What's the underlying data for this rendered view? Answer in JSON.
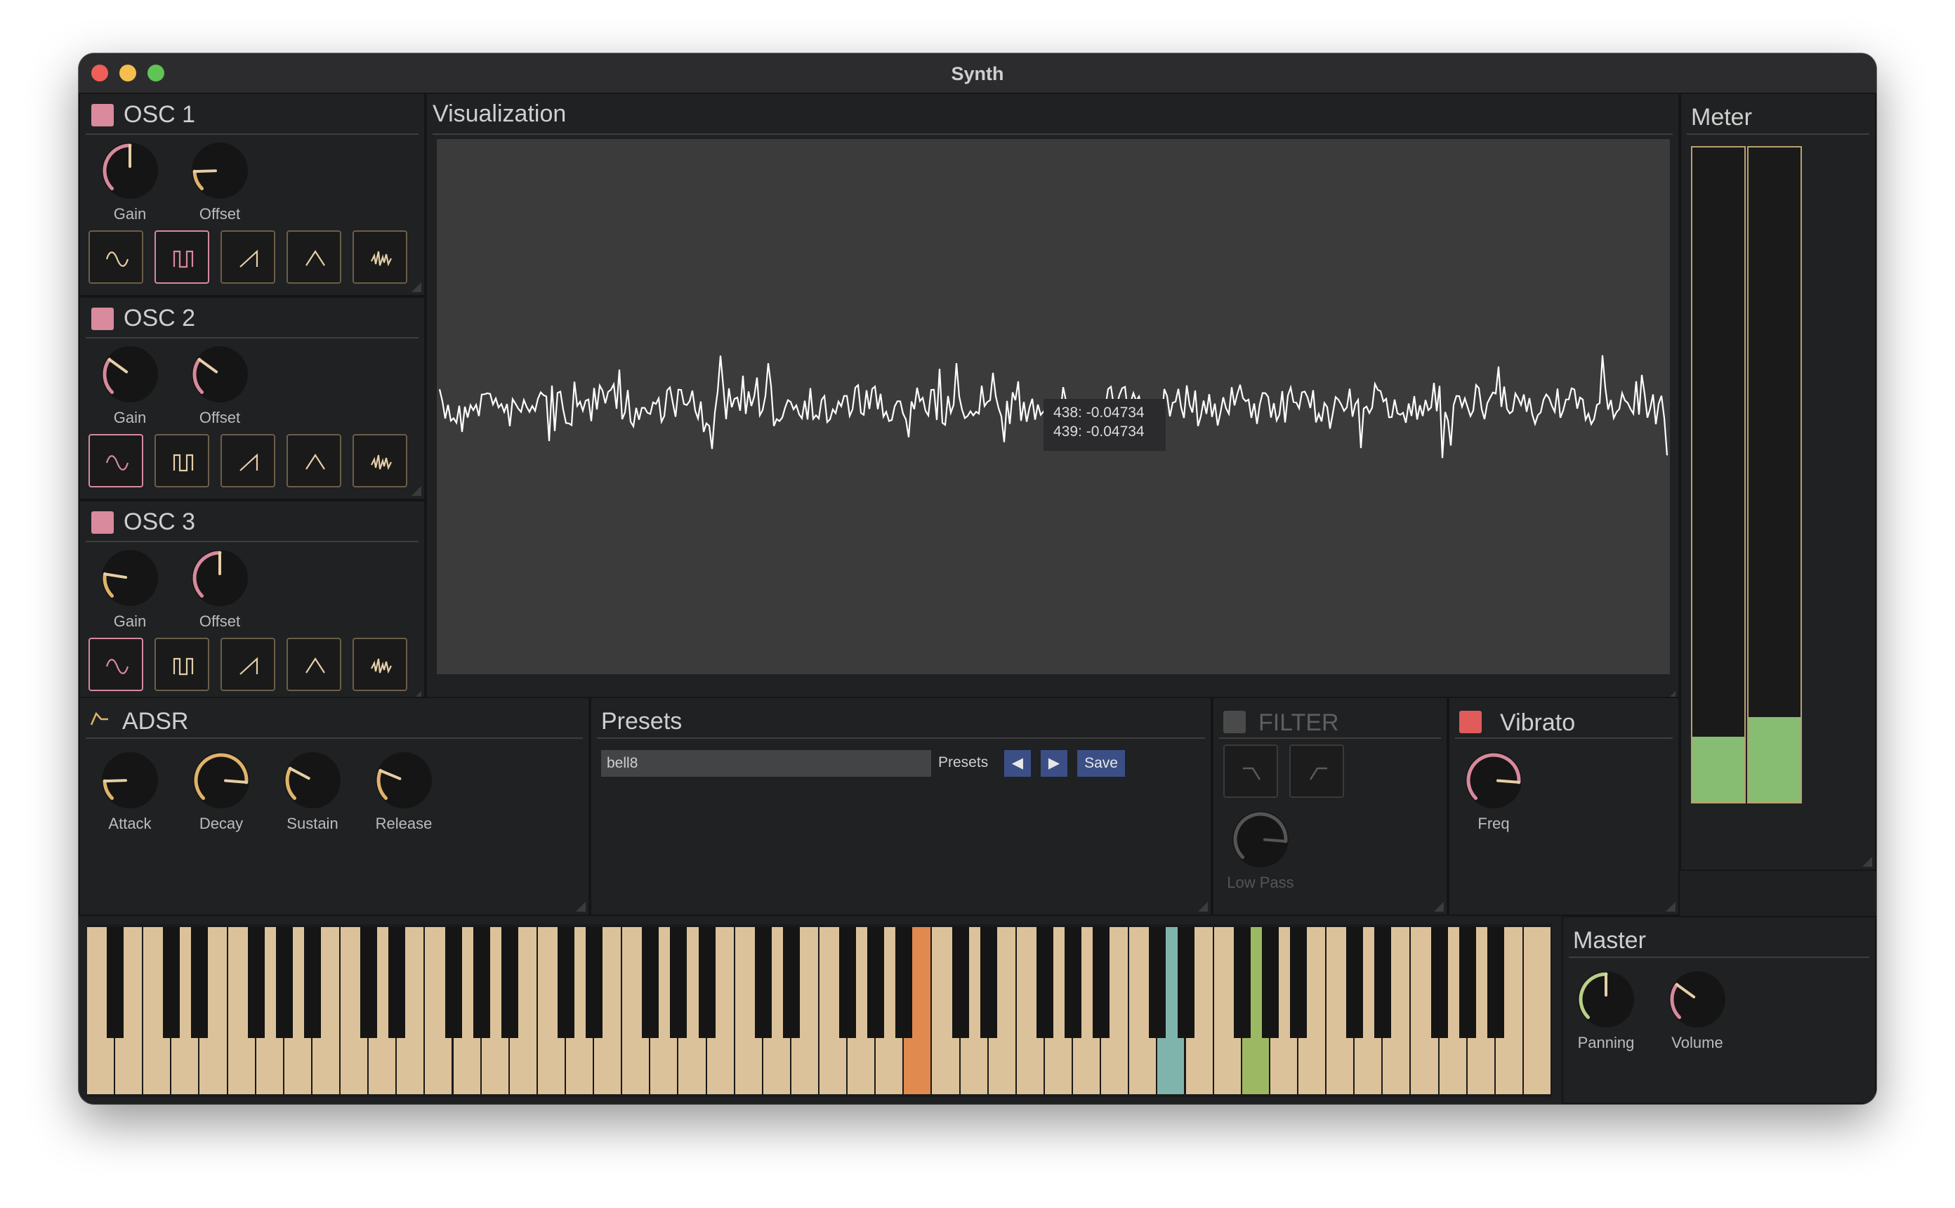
{
  "window": {
    "title": "Synth"
  },
  "colors": {
    "close": "#ee5f58",
    "minimize": "#f5be4f",
    "zoom": "#5fc454",
    "osc_checkbox": "#d98a9c",
    "vibrato_checkbox": "#e15b5b",
    "filter_checkbox": "#4a4a4a",
    "knob_pink": "#d8899c",
    "knob_gold": "#e0b36a",
    "knob_green": "#b9cf86",
    "wave_line": "#ffffff",
    "meter_fill": "#86bd73",
    "key_white": "#dcc29a",
    "key_orange": "#e08a4f",
    "key_teal": "#7fb4ad",
    "key_green": "#9db862",
    "button_blue": "#3b4f86"
  },
  "oscillators": [
    {
      "title": "OSC 1",
      "enabled": true,
      "knobs": [
        {
          "label": "Gain",
          "value": 0.5,
          "color": "pink"
        },
        {
          "label": "Offset",
          "value": 0.16,
          "color": "gold"
        }
      ],
      "waveforms": [
        "sine",
        "square",
        "saw",
        "triangle",
        "noise"
      ],
      "selected": "square"
    },
    {
      "title": "OSC 2",
      "enabled": true,
      "knobs": [
        {
          "label": "Gain",
          "value": 0.3,
          "color": "pink"
        },
        {
          "label": "Offset",
          "value": 0.3,
          "color": "pink"
        }
      ],
      "waveforms": [
        "sine",
        "square",
        "saw",
        "triangle",
        "noise"
      ],
      "selected": "sine"
    },
    {
      "title": "OSC 3",
      "enabled": true,
      "knobs": [
        {
          "label": "Gain",
          "value": 0.2,
          "color": "gold"
        },
        {
          "label": "Offset",
          "value": 0.5,
          "color": "pink"
        }
      ],
      "waveforms": [
        "sine",
        "square",
        "saw",
        "triangle",
        "noise"
      ],
      "selected": "sine"
    }
  ],
  "visualization": {
    "title": "Visualization",
    "tooltip": [
      "438: -0.04734",
      "439: -0.04734"
    ]
  },
  "meter": {
    "title": "Meter",
    "levels": [
      0.1,
      0.13
    ]
  },
  "adsr": {
    "title": "ADSR",
    "icon": "envelope-icon",
    "knobs": [
      {
        "label": "Attack",
        "value": 0.16,
        "color": "gold"
      },
      {
        "label": "Decay",
        "value": 0.85,
        "color": "gold"
      },
      {
        "label": "Sustain",
        "value": 0.27,
        "color": "gold"
      },
      {
        "label": "Release",
        "value": 0.25,
        "color": "gold"
      }
    ]
  },
  "presets": {
    "title": "Presets",
    "current": "bell8",
    "label": "Presets",
    "prev_icon": "◀",
    "next_icon": "▶",
    "save_label": "Save"
  },
  "filter": {
    "title": "FILTER",
    "enabled": false,
    "types": [
      "low-pass-icon",
      "high-pass-icon"
    ],
    "knob": {
      "label": "Low Pass",
      "value": 0.85
    }
  },
  "vibrato": {
    "title": "Vibrato",
    "enabled": true,
    "knob": {
      "label": "Freq",
      "value": 0.85,
      "color": "pink"
    }
  },
  "master": {
    "title": "Master",
    "knobs": [
      {
        "label": "Panning",
        "value": 0.5,
        "color": "green"
      },
      {
        "label": "Volume",
        "value": 0.3,
        "color": "pink"
      }
    ]
  },
  "keyboard": {
    "white_keys": 52,
    "highlighted": [
      {
        "key": 29,
        "color": "orange"
      },
      {
        "key": 38,
        "color": "teal"
      },
      {
        "key": 41,
        "color": "green"
      }
    ]
  }
}
